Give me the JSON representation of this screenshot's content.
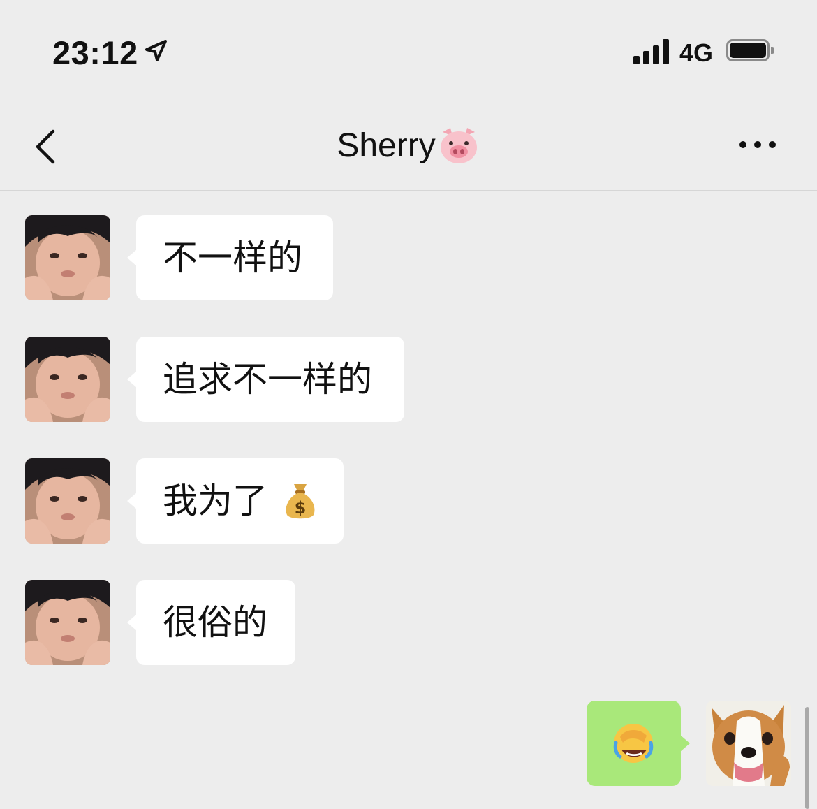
{
  "status_bar": {
    "time": "23:12",
    "network": "4G"
  },
  "header": {
    "title": "Sherry",
    "title_emoji": "pig-face-icon"
  },
  "messages": [
    {
      "side": "incoming",
      "text": "不一样的"
    },
    {
      "side": "incoming",
      "text": "追求不一样的"
    },
    {
      "side": "incoming",
      "text": "我为了",
      "emoji": "money-bag-icon"
    },
    {
      "side": "incoming",
      "text": "很俗的"
    },
    {
      "side": "outgoing",
      "emoji": "facepalm-laugh-icon"
    }
  ],
  "colors": {
    "background": "#ededed",
    "incoming_bubble": "#ffffff",
    "outgoing_bubble": "#a9e87a",
    "text": "#111111"
  }
}
